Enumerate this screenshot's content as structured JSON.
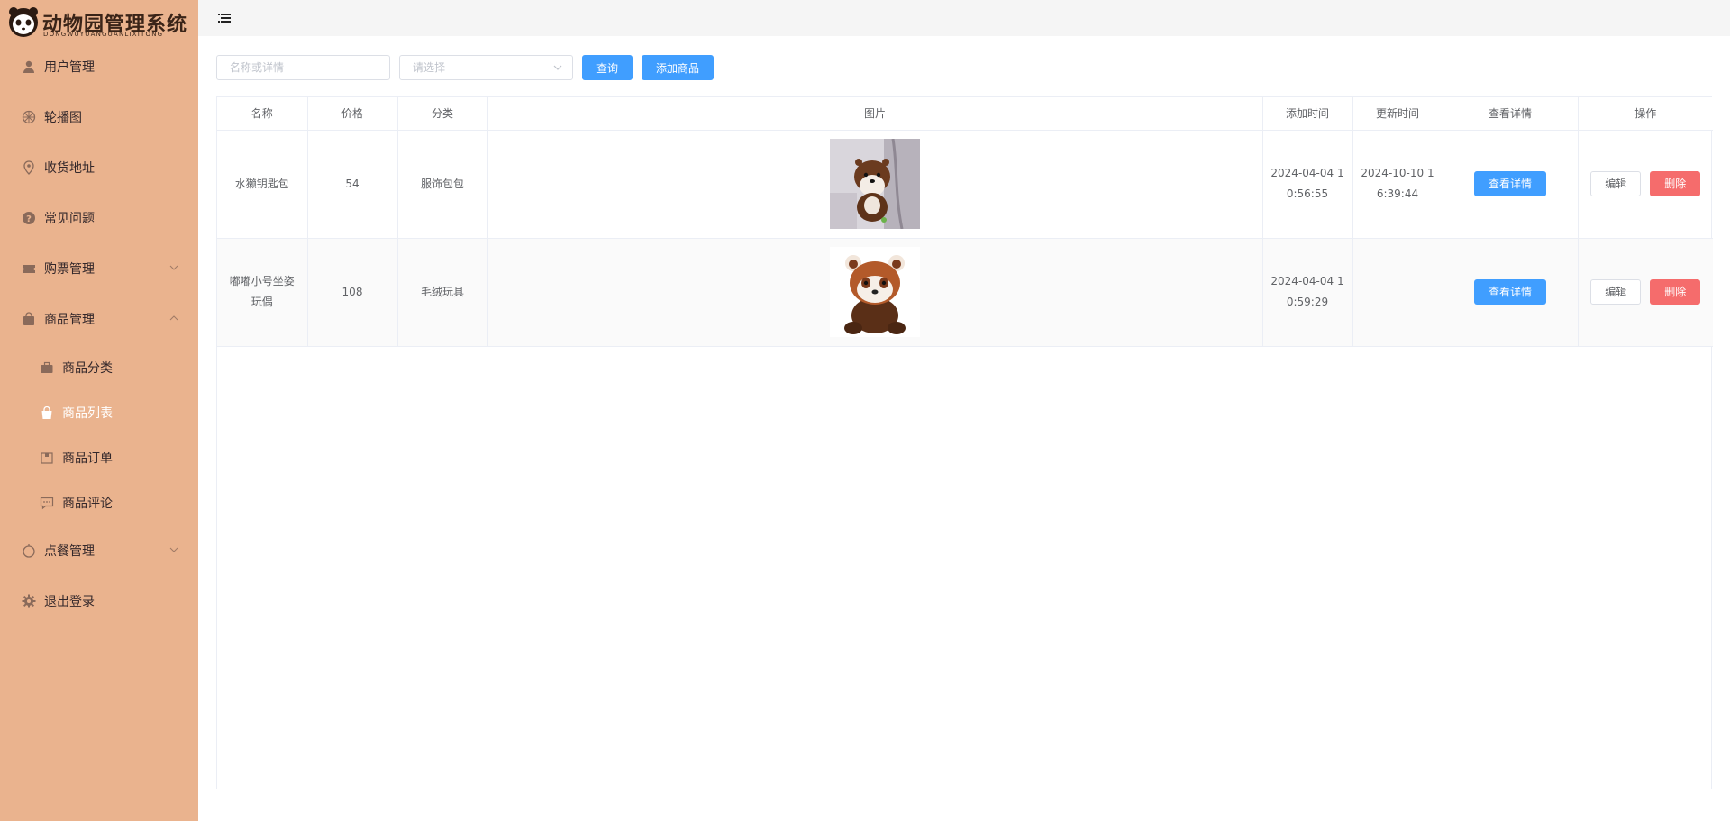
{
  "app": {
    "title": "动物园管理系统",
    "subtitle": "DONGWUYUANGUANLIXITONG"
  },
  "sidebar": {
    "items": [
      {
        "label": "用户管理",
        "icon": "user-icon"
      },
      {
        "label": "轮播图",
        "icon": "carousel-icon"
      },
      {
        "label": "收货地址",
        "icon": "location-icon"
      },
      {
        "label": "常见问题",
        "icon": "question-icon"
      },
      {
        "label": "购票管理",
        "icon": "ticket-icon",
        "expandable": true
      },
      {
        "label": "商品管理",
        "icon": "bag-icon",
        "expandable": true,
        "expanded": true
      },
      {
        "label": "点餐管理",
        "icon": "food-icon",
        "expandable": true
      },
      {
        "label": "退出登录",
        "icon": "gear-icon"
      }
    ],
    "sub_items": [
      {
        "label": "商品分类",
        "icon": "briefcase-icon"
      },
      {
        "label": "商品列表",
        "icon": "shopping-bag-icon",
        "active": true
      },
      {
        "label": "商品订单",
        "icon": "order-box-icon"
      },
      {
        "label": "商品评论",
        "icon": "comment-icon"
      }
    ]
  },
  "filters": {
    "name_placeholder": "名称或详情",
    "select_placeholder": "请选择",
    "query_label": "查询",
    "add_label": "添加商品"
  },
  "table": {
    "headers": [
      "名称",
      "价格",
      "分类",
      "图片",
      "添加时间",
      "更新时间",
      "查看详情",
      "操作"
    ],
    "rows": [
      {
        "name": "水獭钥匙包",
        "price": "54",
        "category": "服饰包包",
        "image": "otter-plush-keychain",
        "created": "2024-04-04 10:56:55",
        "updated": "2024-10-10 16:39:44"
      },
      {
        "name": "嘟嘟小号坐姿玩偶",
        "price": "108",
        "category": "毛绒玩具",
        "image": "red-panda-plush",
        "created": "2024-04-04 10:59:29",
        "updated": ""
      }
    ],
    "detail_label": "查看详情",
    "edit_label": "编辑",
    "delete_label": "删除"
  },
  "colors": {
    "sidebar_bg": "#eab38e",
    "primary": "#409eff",
    "danger": "#f56c6c",
    "topbar_bg": "#f5f5f5"
  }
}
